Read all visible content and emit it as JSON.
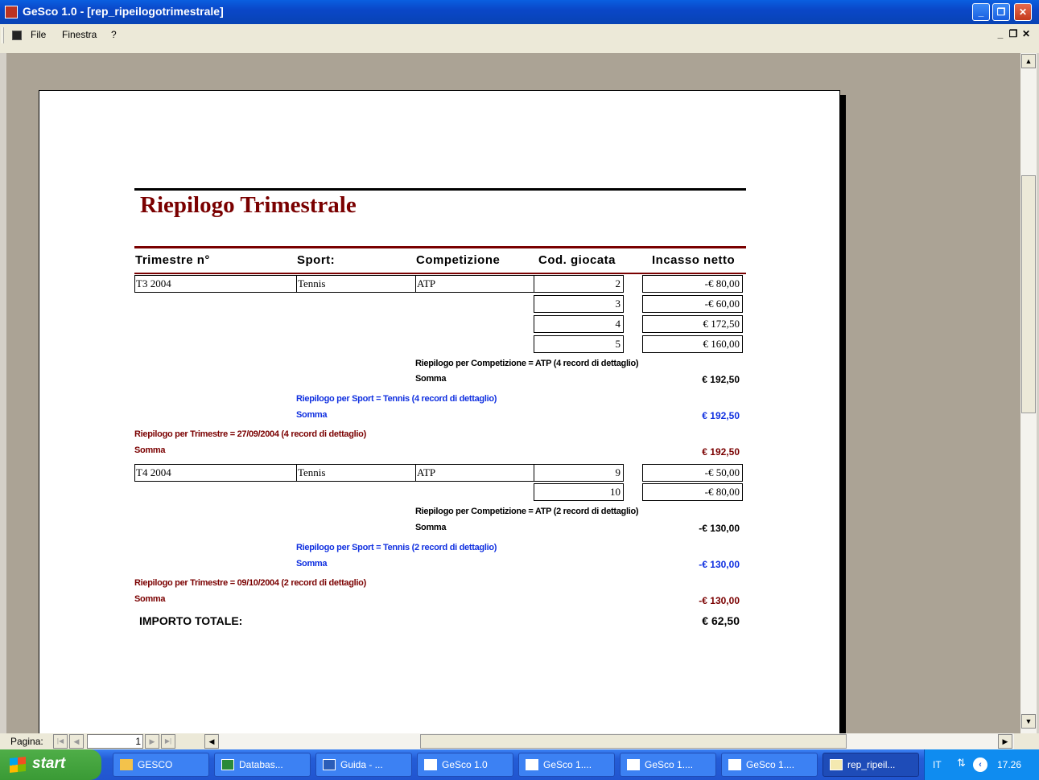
{
  "window": {
    "title": "GeSco 1.0 - [rep_ripeilogotrimestrale]"
  },
  "menu": {
    "items": [
      "File",
      "Finestra",
      "?"
    ]
  },
  "report": {
    "title": "Riepilogo Trimestrale",
    "headers": [
      "Trimestre n°",
      "Sport:",
      "Competizione",
      "Cod. giocata",
      "Incasso netto"
    ],
    "groups": [
      {
        "trimestre": "T3 2004",
        "sport": "Tennis",
        "competizione": "ATP",
        "rows": [
          {
            "cod": "2",
            "incasso": "-€ 80,00"
          },
          {
            "cod": "3",
            "incasso": "-€ 60,00"
          },
          {
            "cod": "4",
            "incasso": "€ 172,50"
          },
          {
            "cod": "5",
            "incasso": "€ 160,00"
          }
        ],
        "comp_summary": "Riepilogo per Competizione =  ATP (4 record di dettaglio)",
        "comp_sum_label": "Somma",
        "comp_sum": "€ 192,50",
        "sport_summary": "Riepilogo per Sport =  Tennis (4 record di dettaglio)",
        "sport_sum_label": "Somma",
        "sport_sum": "€ 192,50",
        "trim_summary": "Riepilogo per Trimestre =  27/09/2004 (4 record di dettaglio)",
        "trim_sum_label": "Somma",
        "trim_sum": "€ 192,50"
      },
      {
        "trimestre": "T4 2004",
        "sport": "Tennis",
        "competizione": "ATP",
        "rows": [
          {
            "cod": "9",
            "incasso": "-€ 50,00"
          },
          {
            "cod": "10",
            "incasso": "-€ 80,00"
          }
        ],
        "comp_summary": "Riepilogo per Competizione =  ATP (2 record di dettaglio)",
        "comp_sum_label": "Somma",
        "comp_sum": "-€ 130,00",
        "sport_summary": "Riepilogo per Sport =  Tennis (2 record di dettaglio)",
        "sport_sum_label": "Somma",
        "sport_sum": "-€ 130,00",
        "trim_summary": "Riepilogo per Trimestre =  09/10/2004 (2 record di dettaglio)",
        "trim_sum_label": "Somma",
        "trim_sum": "-€ 130,00"
      }
    ],
    "total_label": "IMPORTO TOTALE:",
    "total_value": "€ 62,50"
  },
  "statusbar": {
    "page_label": "Pagina:",
    "page_number": "1"
  },
  "taskbar": {
    "start": "start",
    "items": [
      "GESCO",
      "Databas...",
      "Guida - ...",
      "GeSco 1.0",
      "GeSco 1....",
      "GeSco 1....",
      "GeSco 1....",
      "rep_ripeil..."
    ],
    "lang": "IT",
    "clock": "17.26"
  },
  "colors": {
    "report_title": "#7a0000",
    "sport_summary": "#1030e0",
    "trim_summary": "#7a0000",
    "desktop": "#aba395"
  }
}
